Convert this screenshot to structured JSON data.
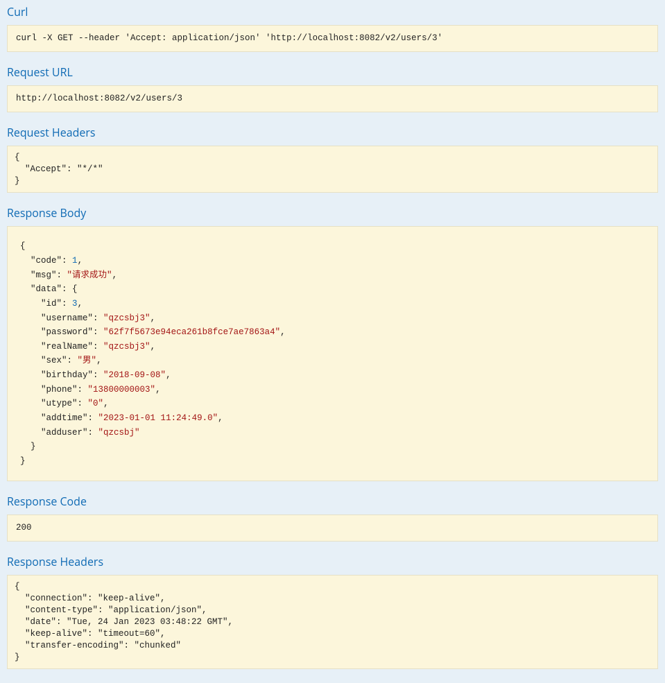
{
  "sections": {
    "curl_heading": "Curl",
    "url_heading": "Request URL",
    "req_headers_heading": "Request Headers",
    "resp_body_heading": "Response Body",
    "resp_code_heading": "Response Code",
    "resp_headers_heading": "Response Headers"
  },
  "curl": "curl -X GET --header 'Accept: application/json' 'http://localhost:8082/v2/users/3'",
  "request_url": "http://localhost:8082/v2/users/3",
  "request_headers": "{\n  \"Accept\": \"*/*\"\n}",
  "response_body_json": {
    "code": 1,
    "msg": "请求成功",
    "data": {
      "id": 3,
      "username": "qzcsbj3",
      "password": "62f7f5673e94eca261b8fce7ae7863a4",
      "realName": "qzcsbj3",
      "sex": "男",
      "birthday": "2018-09-08",
      "phone": "13800000003",
      "utype": "0",
      "addtime": "2023-01-01 11:24:49.0",
      "adduser": "qzcsbj"
    }
  },
  "response_code": "200",
  "response_headers": "{\n  \"connection\": \"keep-alive\",\n  \"content-type\": \"application/json\",\n  \"date\": \"Tue, 24 Jan 2023 03:48:22 GMT\",\n  \"keep-alive\": \"timeout=60\",\n  \"transfer-encoding\": \"chunked\"\n}"
}
